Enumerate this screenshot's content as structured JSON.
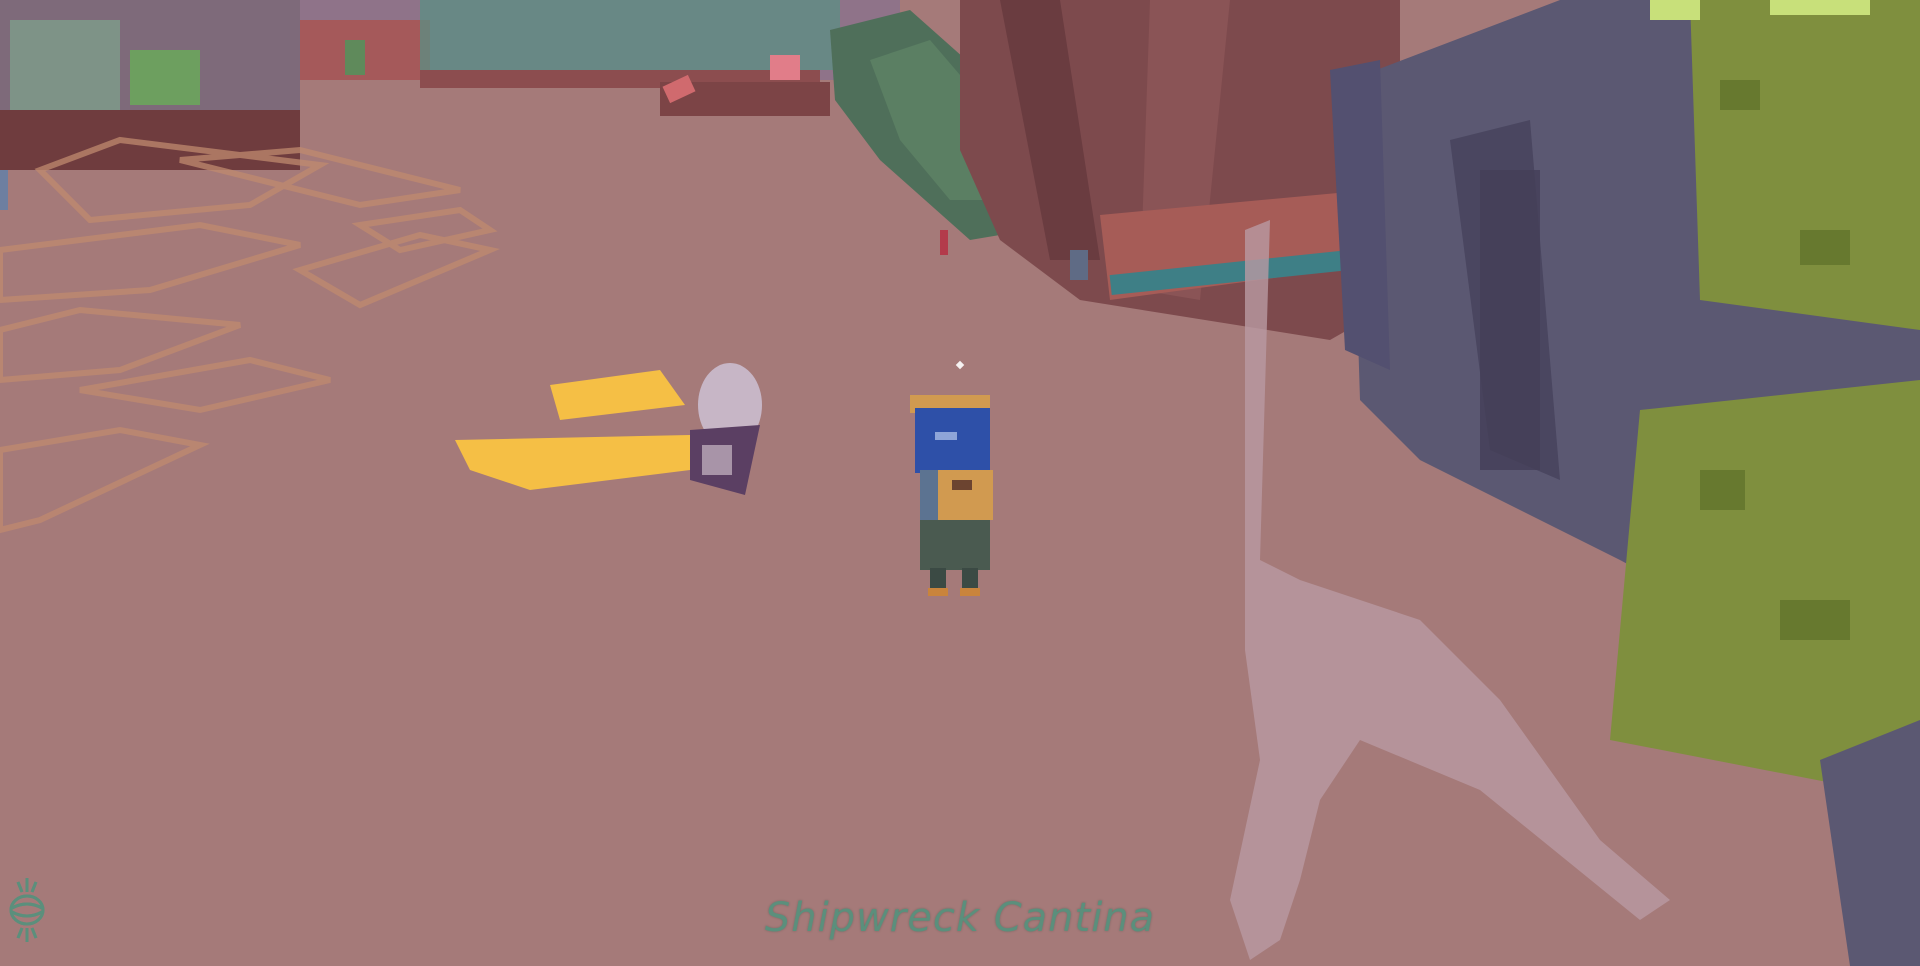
{
  "hud": {
    "location_name": "Shipwreck Cantina",
    "left_emblem_icon": "compass-sigil-icon",
    "right_emblem_icon": "compass-sigil-icon",
    "text_color": "#5b8f7c"
  },
  "scene": {
    "ground_color": "#a57a79",
    "player_character": "player-character",
    "companion_robot": "hover-robot"
  }
}
